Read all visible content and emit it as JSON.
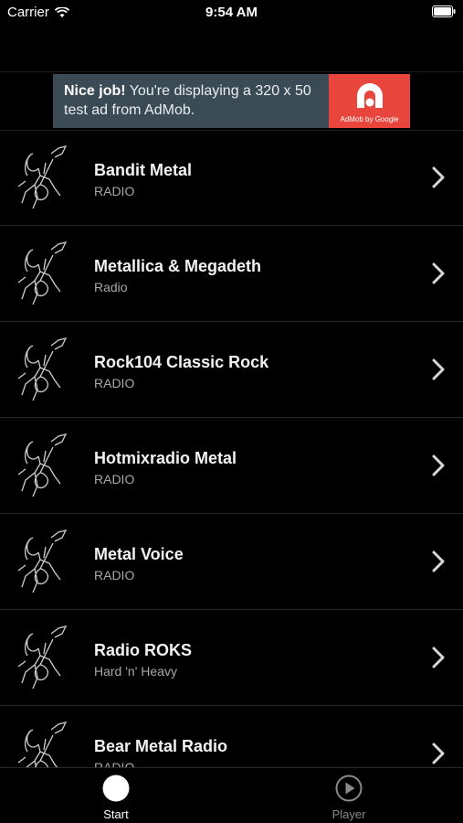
{
  "status_bar": {
    "carrier": "Carrier",
    "time": "9:54 AM"
  },
  "ad": {
    "bold_text": "Nice job!",
    "text": " You're displaying a 320 x 50 test ad from AdMob.",
    "logo_caption": "AdMob by Google",
    "logo_color": "#e8453c",
    "background_color": "#3b4b55"
  },
  "stations": [
    {
      "title": "Bandit Metal",
      "subtitle": "RADIO"
    },
    {
      "title": "Metallica & Megadeth",
      "subtitle": "Radio"
    },
    {
      "title": "Rock104 Classic Rock",
      "subtitle": "RADIO"
    },
    {
      "title": "Hotmixradio Metal",
      "subtitle": "RADIO"
    },
    {
      "title": "Metal Voice",
      "subtitle": "RADIO"
    },
    {
      "title": "Radio ROKS",
      "subtitle": "Hard 'n' Heavy"
    },
    {
      "title": "Bear Metal Radio",
      "subtitle": "RADIO"
    }
  ],
  "tabbar": {
    "start_label": "Start",
    "player_label": "Player",
    "start_icon": "filled-circle-icon",
    "player_icon": "play-circle-icon"
  }
}
